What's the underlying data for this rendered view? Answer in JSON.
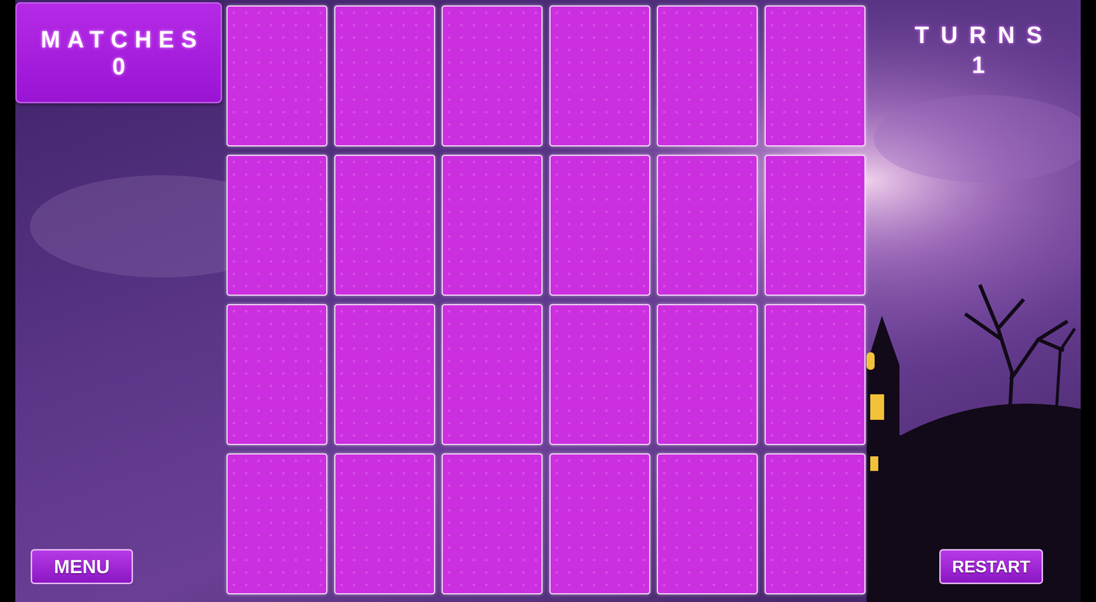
{
  "matches": {
    "label": "MATCHES",
    "value": "0"
  },
  "turns": {
    "label": "TURNS",
    "value": "1"
  },
  "cards": [
    {
      "flipped": false
    },
    {
      "flipped": false
    },
    {
      "flipped": false
    },
    {
      "flipped": false
    },
    {
      "flipped": false
    },
    {
      "flipped": false
    },
    {
      "flipped": false
    },
    {
      "flipped": false
    },
    {
      "flipped": false
    },
    {
      "flipped": false
    },
    {
      "flipped": false
    },
    {
      "flipped": false
    },
    {
      "flipped": false
    },
    {
      "flipped": false
    },
    {
      "flipped": false
    },
    {
      "flipped": false
    },
    {
      "flipped": false
    },
    {
      "flipped": false
    },
    {
      "flipped": false
    },
    {
      "flipped": false
    },
    {
      "flipped": false
    },
    {
      "flipped": false
    },
    {
      "flipped": false
    },
    {
      "flipped": false
    }
  ],
  "buttons": {
    "menu": "MENU",
    "restart": "RESTART"
  }
}
